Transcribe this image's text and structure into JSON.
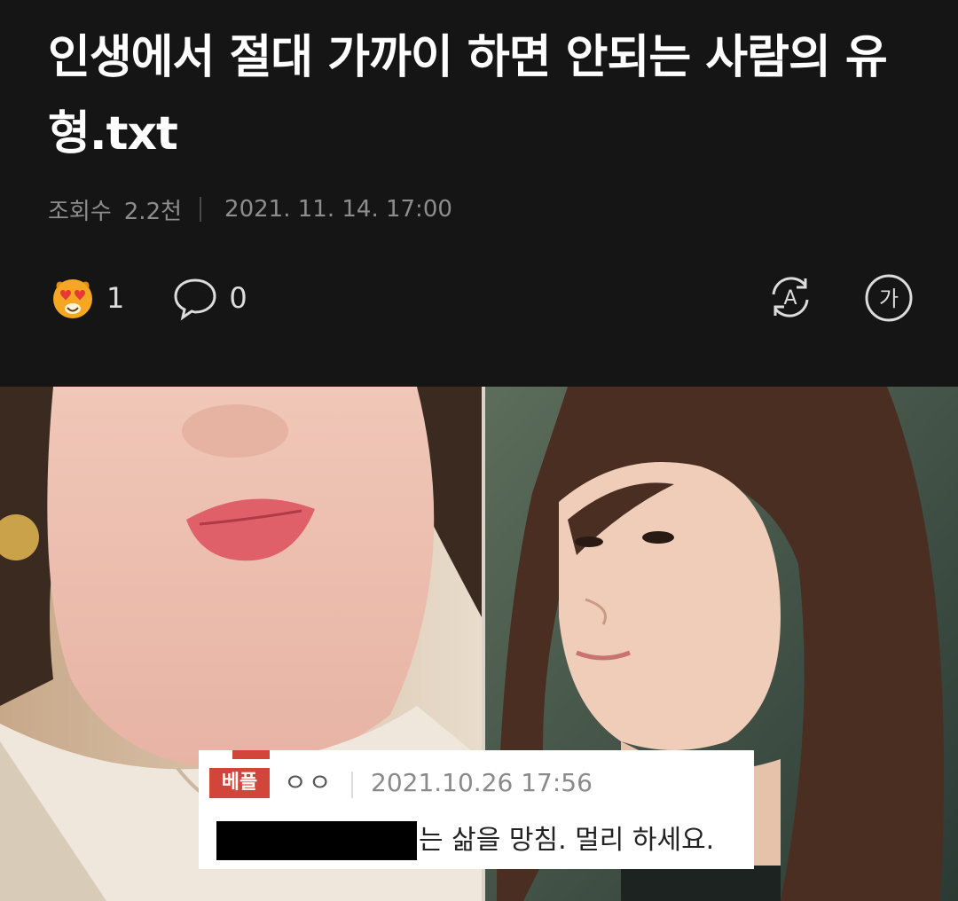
{
  "post": {
    "title": "인생에서 절대 가까이 하면 안되는 사람의 유형.txt",
    "views_label": "조회수",
    "views_value": "2.2천",
    "datetime": "2021. 11. 14. 17:00"
  },
  "actions": {
    "reaction_count": "1",
    "comment_count": "0",
    "reaction_icon": "heart-eyes-emoji-icon",
    "comment_icon": "speech-bubble-icon",
    "translate_icon": "translate-icon",
    "font_size_icon": "font-size-icon",
    "font_size_glyph": "가",
    "translate_glyph": "A"
  },
  "image_comment": {
    "badge": "베플",
    "username": "ㅇㅇ",
    "date": "2021.10.26 17:56",
    "text": "는 삶을 망침. 멀리 하세요."
  },
  "colors": {
    "background": "#151515",
    "badge_red": "#d1453b",
    "meta_gray": "#8d8d8d"
  }
}
